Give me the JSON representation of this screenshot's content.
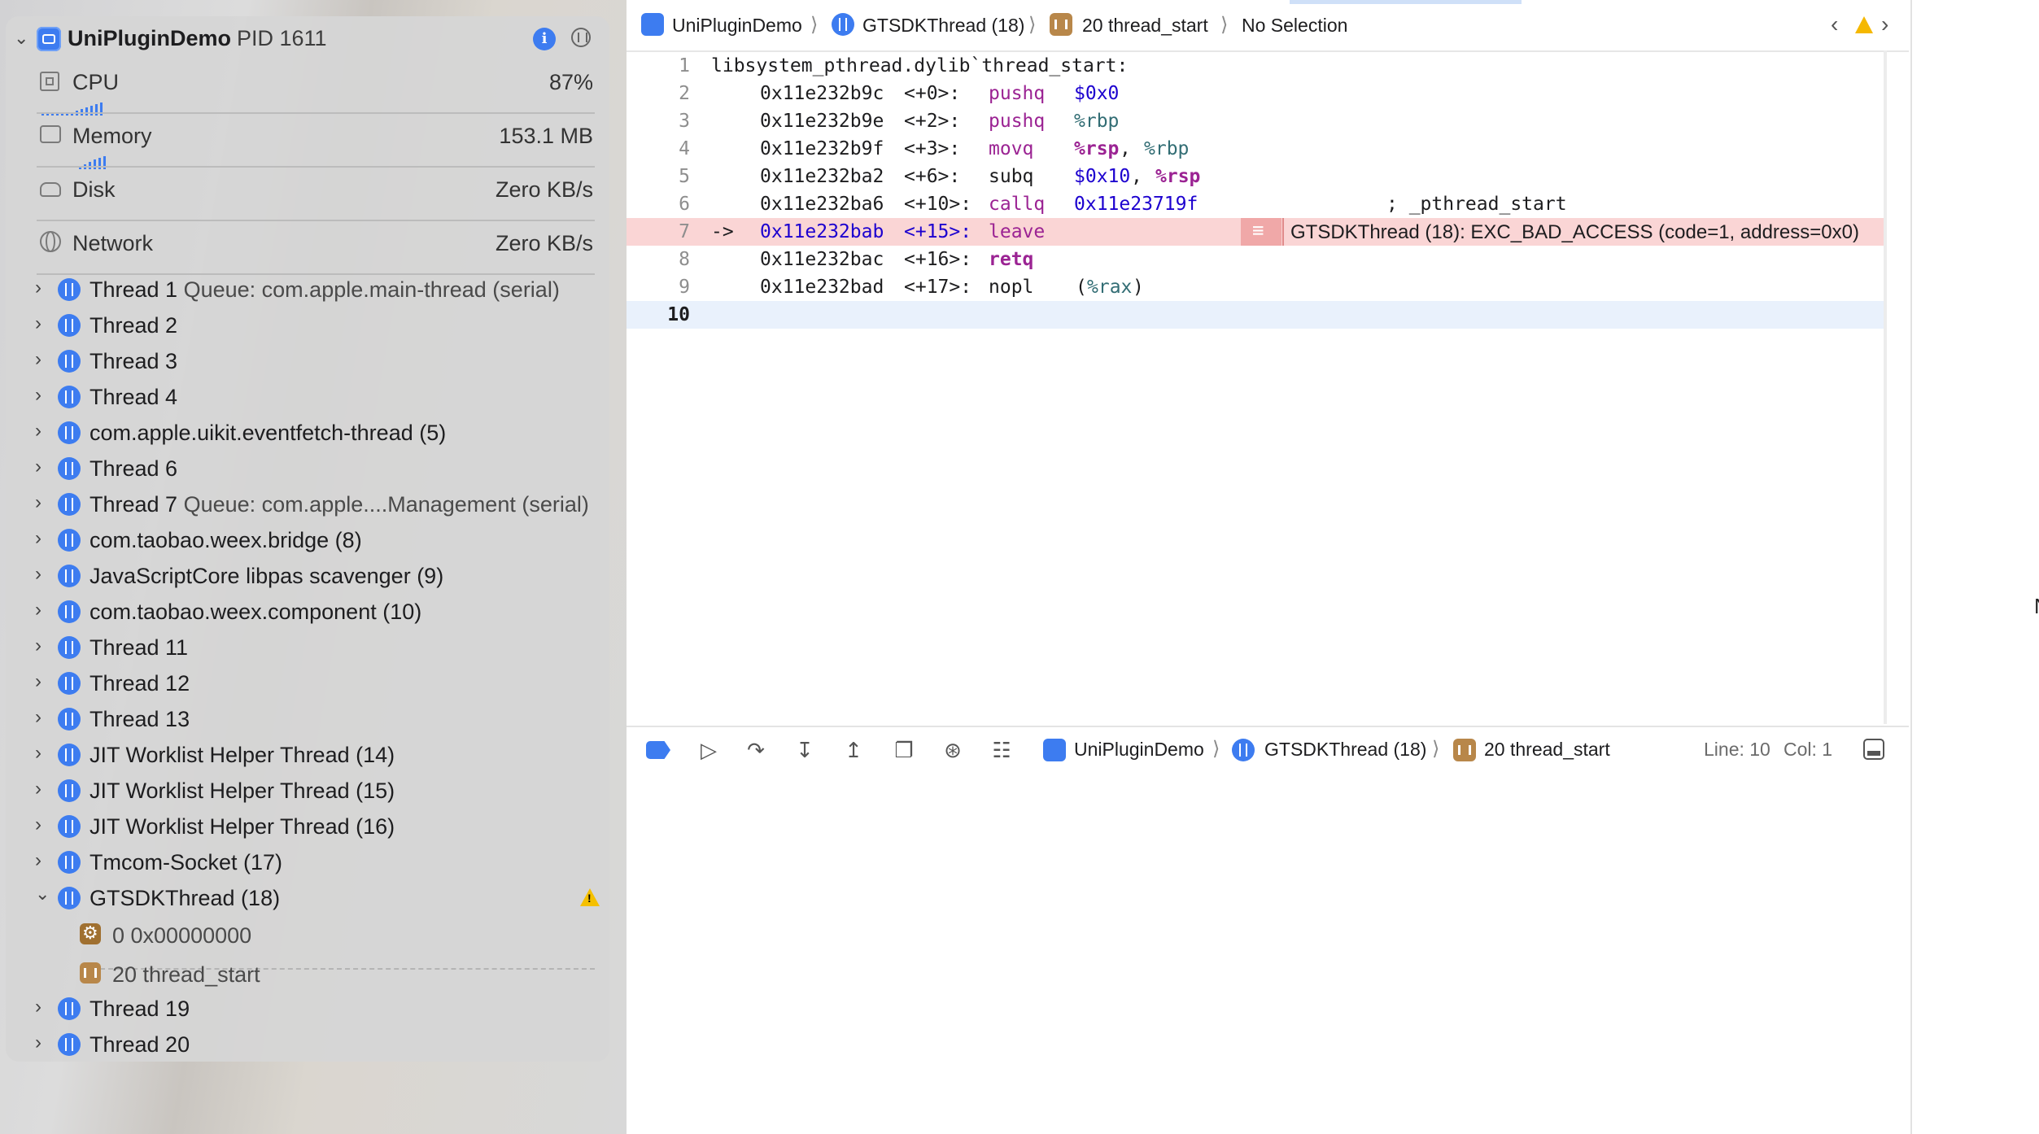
{
  "process": {
    "name": "UniPluginDemo",
    "pid": "PID 1611"
  },
  "gauges": [
    {
      "label": "CPU",
      "value": "87%",
      "icon": "cpu-icon"
    },
    {
      "label": "Memory",
      "value": "153.1 MB",
      "icon": "memory-icon"
    },
    {
      "label": "Disk",
      "value": "Zero KB/s",
      "icon": "disk-icon"
    },
    {
      "label": "Network",
      "value": "Zero KB/s",
      "icon": "network-icon"
    }
  ],
  "threads": [
    {
      "label": "Thread 1",
      "sub": "Queue: com.apple.main-thread (serial)"
    },
    {
      "label": "Thread 2",
      "sub": ""
    },
    {
      "label": "Thread 3",
      "sub": ""
    },
    {
      "label": "Thread 4",
      "sub": ""
    },
    {
      "label": "com.apple.uikit.eventfetch-thread (5)",
      "sub": ""
    },
    {
      "label": "Thread 6",
      "sub": ""
    },
    {
      "label": "Thread 7",
      "sub": "Queue: com.apple....Management (serial)"
    },
    {
      "label": "com.taobao.weex.bridge (8)",
      "sub": ""
    },
    {
      "label": "JavaScriptCore libpas scavenger (9)",
      "sub": ""
    },
    {
      "label": "com.taobao.weex.component (10)",
      "sub": ""
    },
    {
      "label": "Thread 11",
      "sub": ""
    },
    {
      "label": "Thread 12",
      "sub": ""
    },
    {
      "label": "Thread 13",
      "sub": ""
    },
    {
      "label": "JIT Worklist Helper Thread (14)",
      "sub": ""
    },
    {
      "label": "JIT Worklist Helper Thread (15)",
      "sub": ""
    },
    {
      "label": "JIT Worklist Helper Thread (16)",
      "sub": ""
    },
    {
      "label": "Tmcom-Socket (17)",
      "sub": ""
    },
    {
      "label": "GTSDKThread (18)",
      "sub": ""
    }
  ],
  "frames": [
    {
      "label": "0 0x00000000"
    },
    {
      "label": "20 thread_start"
    }
  ],
  "threads_after": [
    {
      "label": "Thread 19"
    },
    {
      "label": "Thread 20"
    }
  ],
  "jumpbar": {
    "app": "UniPluginDemo",
    "thread": "GTSDKThread (18)",
    "frame": "20 thread_start",
    "selection": "No Selection"
  },
  "code": {
    "header": "libsystem_pthread.dylib`thread_start:",
    "lines": [
      {
        "n": "1"
      },
      {
        "n": "2"
      },
      {
        "n": "3"
      },
      {
        "n": "4"
      },
      {
        "n": "5"
      },
      {
        "n": "6"
      },
      {
        "n": "7"
      },
      {
        "n": "8"
      },
      {
        "n": "9"
      },
      {
        "n": "10"
      }
    ],
    "l2": {
      "addr": "0x11e232b9c",
      "off": "<+0>:",
      "op": "pushq",
      "a1": "$0x0"
    },
    "l3": {
      "addr": "0x11e232b9e",
      "off": "<+2>:",
      "op": "pushq",
      "a1": "%rbp"
    },
    "l4": {
      "addr": "0x11e232b9f",
      "off": "<+3>:",
      "op": "movq",
      "a1": "%rsp",
      "comma": ",",
      "a2": "%rbp"
    },
    "l5": {
      "addr": "0x11e232ba2",
      "off": "<+6>:",
      "op": "subq",
      "a1": "$0x10",
      "comma": ",",
      "a2": "%rsp"
    },
    "l6": {
      "addr": "0x11e232ba6",
      "off": "<+10>:",
      "op": "callq",
      "a1": "0x11e23719f",
      "comment": "; _pthread_start"
    },
    "l7": {
      "arrow": "->",
      "addr": "0x11e232bab",
      "off": "<+15>:",
      "op": "leave"
    },
    "l8": {
      "addr": "0x11e232bac",
      "off": "<+16>:",
      "op": "retq"
    },
    "l9": {
      "addr": "0x11e232bad",
      "off": "<+17>:",
      "op": "nopl",
      "a1": "(",
      "a2": "%rax",
      "a3": ")"
    },
    "error": "GTSDKThread (18): EXC_BAD_ACCESS (code=1, address=0x0)"
  },
  "debugbar": {
    "app": "UniPluginDemo",
    "thread": "GTSDKThread (18)",
    "frame": "20 thread_start",
    "line": "Line: 10",
    "col": "Col: 1"
  },
  "colors": {
    "accent": "#3d7cf0",
    "error_bg": "#fad5d5",
    "keyword": "#9b2393",
    "number": "#1c00cf",
    "warning": "#f5c000"
  }
}
